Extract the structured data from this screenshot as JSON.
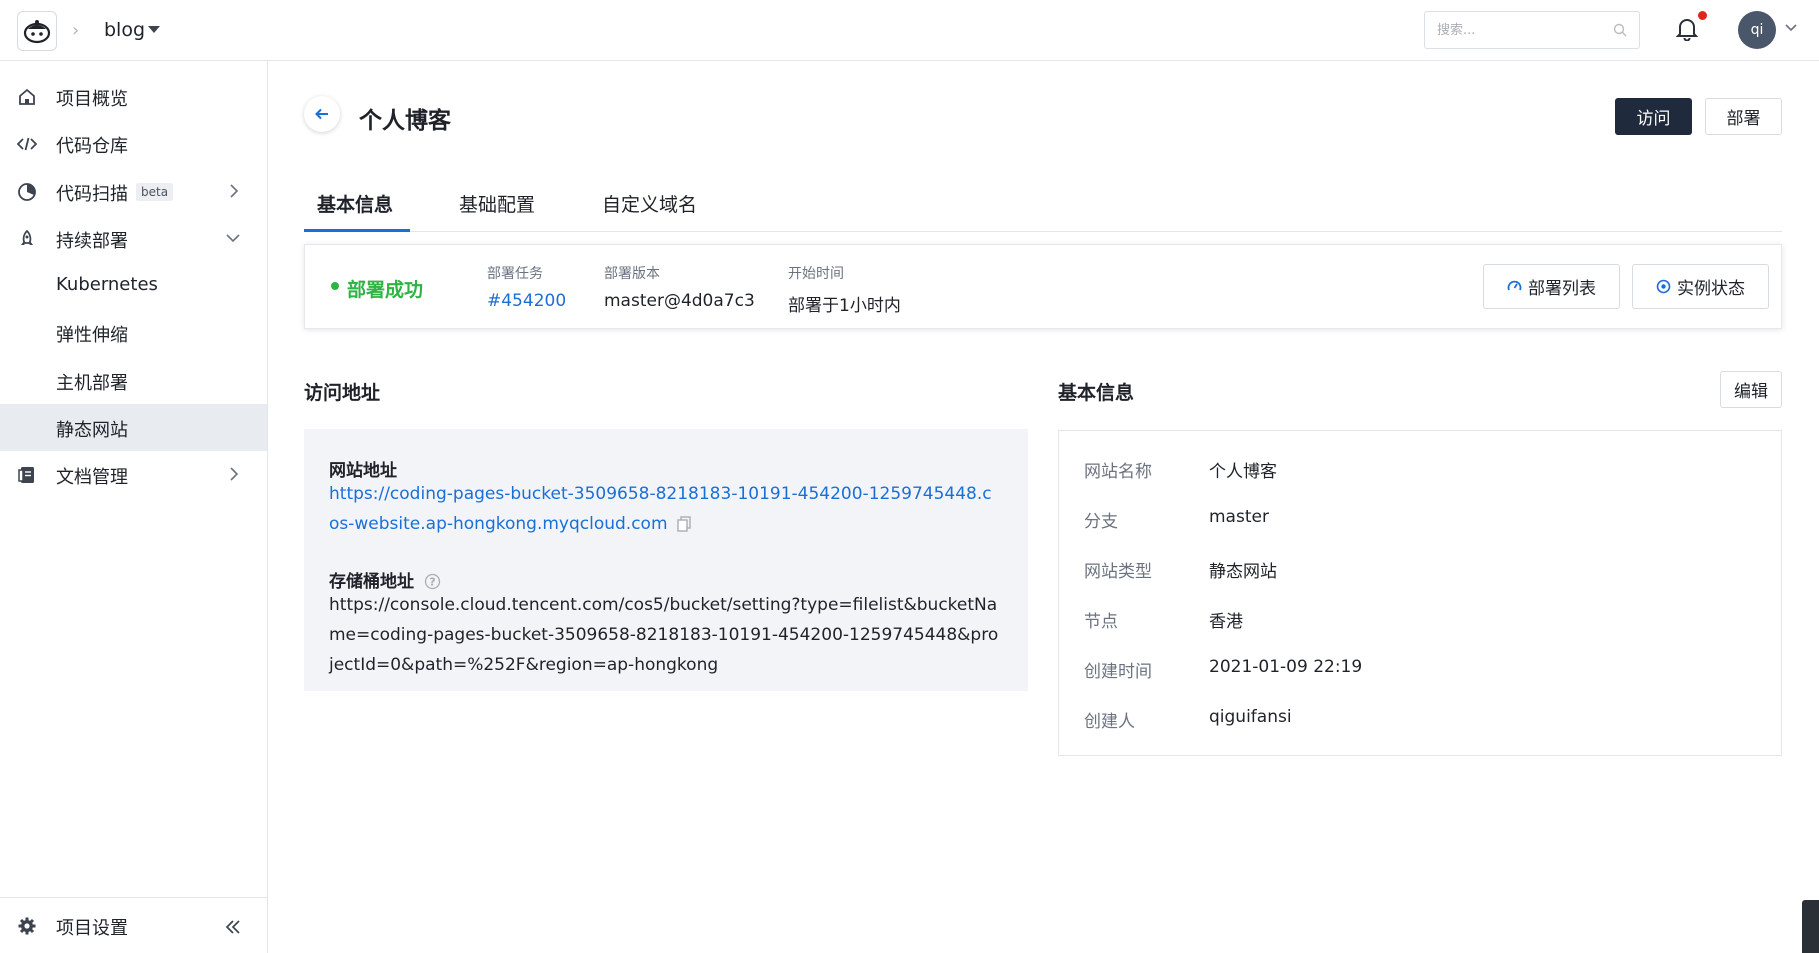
{
  "header": {
    "project_name": "blog",
    "search_placeholder": "搜索...",
    "avatar_text": "qi"
  },
  "sidebar": {
    "items": [
      {
        "label": "项目概览",
        "icon": "home-icon"
      },
      {
        "label": "代码仓库",
        "icon": "code-icon"
      },
      {
        "label": "代码扫描",
        "icon": "scan-icon",
        "badge": "beta"
      },
      {
        "label": "持续部署",
        "icon": "rocket-icon"
      },
      {
        "label": "Kubernetes"
      },
      {
        "label": "弹性伸缩"
      },
      {
        "label": "主机部署"
      },
      {
        "label": "静态网站",
        "active": true
      },
      {
        "label": "文档管理",
        "icon": "document-icon"
      }
    ],
    "footer_label": "项目设置"
  },
  "page": {
    "title": "个人博客",
    "visit_button": "访问",
    "deploy_button": "部署"
  },
  "tabs": [
    {
      "label": "基本信息",
      "active": true
    },
    {
      "label": "基础配置"
    },
    {
      "label": "自定义域名"
    }
  ],
  "status": {
    "text": "部署成功",
    "task_label": "部署任务",
    "task_value": "#454200",
    "version_label": "部署版本",
    "version_value": "master@4d0a7c3",
    "start_label": "开始时间",
    "start_value": "部署于1小时内",
    "deploy_list_button": "部署列表",
    "instance_status_button": "实例状态",
    "color": "#2fb344"
  },
  "access": {
    "section_title": "访问地址",
    "site_label": "网站地址",
    "site_url": "https://coding-pages-bucket-3509658-8218183-10191-454200-1259745448.cos-website.ap-hongkong.myqcloud.com",
    "bucket_label": "存储桶地址",
    "bucket_url": "https://console.cloud.tencent.com/cos5/bucket/setting?type=filelist&bucketName=coding-pages-bucket-3509658-8218183-10191-454200-1259745448&projectId=0&path=%252F&region=ap-hongkong"
  },
  "basic_info": {
    "section_title": "基本信息",
    "edit_button": "编辑",
    "rows": [
      {
        "key": "网站名称",
        "value": "个人博客"
      },
      {
        "key": "分支",
        "value": "master"
      },
      {
        "key": "网站类型",
        "value": "静态网站"
      },
      {
        "key": "节点",
        "value": "香港"
      },
      {
        "key": "创建时间",
        "value": "2021-01-09 22:19"
      },
      {
        "key": "创建人",
        "value": "qiguifansi"
      }
    ]
  },
  "colors": {
    "primary_dark": "#1f2a3c",
    "link_blue": "#1a6fd6",
    "success_green": "#2fb344",
    "notification_red": "#e5231b"
  }
}
